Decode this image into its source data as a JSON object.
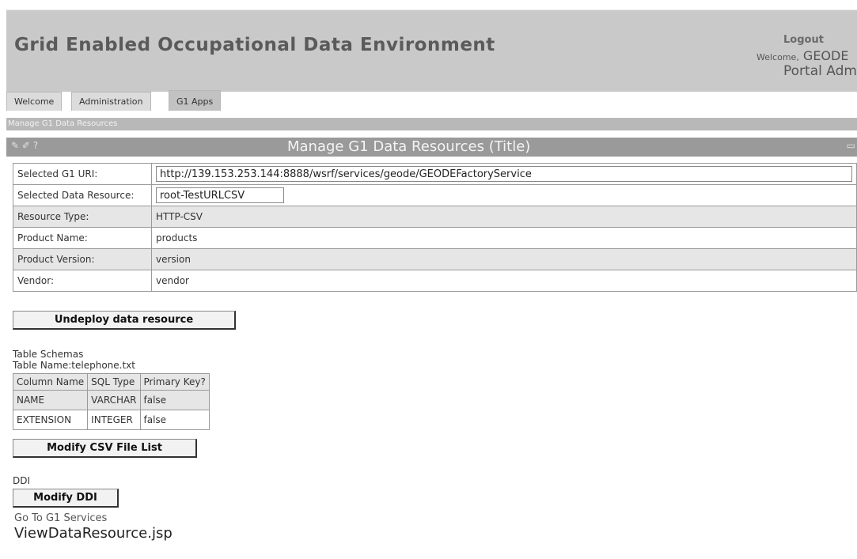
{
  "header": {
    "title": "Grid Enabled Occupational Data Environment",
    "logout": "Logout",
    "welcome_prefix": "Welcome,",
    "welcome_user": "GEODE",
    "role": "Portal Admin"
  },
  "tabs": [
    {
      "label": "Welcome"
    },
    {
      "label": "Administration"
    },
    {
      "label": "G1 Apps"
    }
  ],
  "breadcrumb": "Manage G1 Data Resources",
  "portlet": {
    "icons": "✎ ✐ ?",
    "title": "Manage G1 Data Resources (Title)"
  },
  "properties": {
    "uri_label": "Selected G1 URI:",
    "uri_value": "http://139.153.253.144:8888/wsrf/services/geode/GEODEFactoryService",
    "resource_label": "Selected Data Resource:",
    "resource_value": "root-TestURLCSV",
    "type_label": "Resource Type:",
    "type_value": "HTTP-CSV",
    "product_label": "Product Name:",
    "product_value": "products",
    "version_label": "Product Version:",
    "version_value": "version",
    "vendor_label": "Vendor:",
    "vendor_value": "vendor"
  },
  "buttons": {
    "undeploy": "Undeploy data resource",
    "modify_csv": "Modify CSV File List",
    "modify_ddi": "Modify DDI"
  },
  "schema": {
    "heading": "Table Schemas",
    "table_name": "Table Name:telephone.txt",
    "columns": [
      "Column Name",
      "SQL Type",
      "Primary Key?"
    ],
    "rows": [
      [
        "NAME",
        "VARCHAR",
        "false"
      ],
      [
        "EXTENSION",
        "INTEGER",
        "false"
      ]
    ]
  },
  "ddi_label": "DDI",
  "go_to_services": "Go To G1 Services",
  "footer_page": "ViewDataResource.jsp"
}
